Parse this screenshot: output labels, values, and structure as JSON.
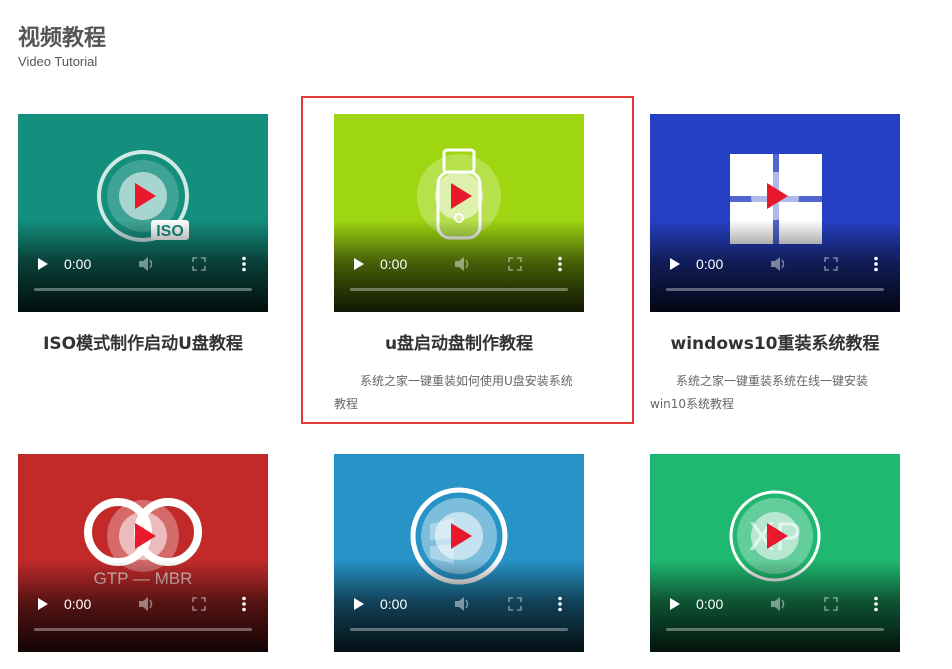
{
  "header": {
    "title": "视频教程",
    "subtitle": "Video Tutorial"
  },
  "colors": {
    "highlight": "#e23b3b",
    "play_red": "#e8192c"
  },
  "player": {
    "time": "0:00"
  },
  "cards": [
    {
      "title": "ISO模式制作启动U盘教程",
      "desc": "",
      "bg": "#148f7d",
      "art": "iso",
      "art_text": "ISO"
    },
    {
      "title": "u盘启动盘制作教程",
      "desc": "系统之家一键重装如何使用U盘安装系统教程",
      "bg": "#9ed611",
      "art": "usb"
    },
    {
      "title": "windows10重装系统教程",
      "desc": "系统之家一键重装系统在线一键安装win10系统教程",
      "bg": "#2540c4",
      "art": "win10"
    },
    {
      "title": "",
      "desc": "",
      "bg": "#c22a2a",
      "art": "gpt",
      "art_text": "GTP — MBR"
    },
    {
      "title": "",
      "desc": "",
      "bg": "#2793c6",
      "art": "win7"
    },
    {
      "title": "",
      "desc": "",
      "bg": "#20b870",
      "art": "xp",
      "art_text": "XP"
    }
  ]
}
